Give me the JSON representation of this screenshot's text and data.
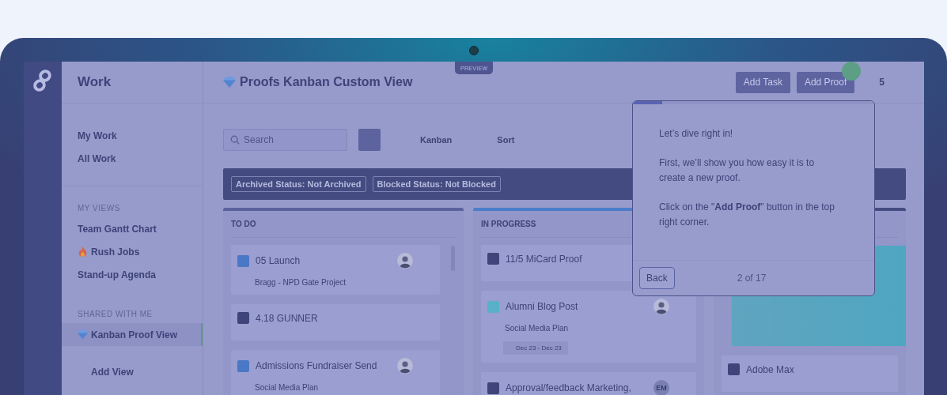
{
  "preview_badge": "PREVIEW",
  "sidebar": {
    "title": "Work",
    "sections": [
      {
        "items": [
          {
            "label": "My Work",
            "kind": "plain",
            "selected": false
          },
          {
            "label": "All Work",
            "kind": "plain",
            "selected": false
          }
        ]
      },
      {
        "heading": "MY VIEWS",
        "items": [
          {
            "label": "Team Gantt Chart",
            "kind": "plain",
            "selected": false
          },
          {
            "label": "Rush Jobs",
            "kind": "fire",
            "selected": false
          },
          {
            "label": "Stand-up Agenda",
            "kind": "plain",
            "selected": false
          }
        ]
      },
      {
        "heading": "SHARED WITH ME",
        "items": [
          {
            "label": "Kanban Proof View",
            "kind": "gem",
            "selected": true
          }
        ]
      }
    ],
    "add_view": "Add View"
  },
  "header": {
    "title": "Proofs Kanban Custom View",
    "buttons": [
      "Add Task",
      "Add Proof"
    ],
    "count": "5"
  },
  "toolbar": {
    "search": {
      "placeholder": "Search"
    },
    "view": "Kanban",
    "sort": "Sort"
  },
  "filters": [
    "Archived Status: Not Archived",
    "Blocked Status: Not Blocked"
  ],
  "columns": [
    {
      "title": "TO DO",
      "color": "#5a619e",
      "scrollbar": true,
      "cards": [
        {
          "kind": "task",
          "title": "05 Launch",
          "color": "#4a78c6",
          "subtitle": "Bragg - NPD Gate Project",
          "avatar": true
        },
        {
          "kind": "task",
          "title": "4.18 GUNNER",
          "color": "#3f457a"
        },
        {
          "kind": "task",
          "title": "Admissions Fundraiser Send",
          "color": "#4a78c6",
          "subtitle": "Social Media Plan",
          "avatar": true
        }
      ]
    },
    {
      "title": "IN PROGRESS",
      "color": "#4c7dcc",
      "cards": [
        {
          "kind": "task",
          "title": "11/5 MiCard Proof",
          "color": "#3f457a"
        },
        {
          "kind": "task",
          "title": "Alumni Blog Post",
          "color": "#5aafc9",
          "subtitle": "Social Media Plan",
          "date": "Dec 23 - Dec 23",
          "avatar": true
        },
        {
          "kind": "task",
          "title": "Approval/feedback Marketing,",
          "color": "#3f457a",
          "initials": "EM"
        }
      ]
    },
    {
      "color": "#454c80",
      "cards": [
        {
          "kind": "image"
        },
        {
          "kind": "task",
          "title": "Adobe Max",
          "color": "#3f457a"
        }
      ]
    }
  ],
  "tour": {
    "level": 0.12,
    "paragraphs": [
      "Let’s dive right in!",
      "First, we’ll show you how easy it is to create a new proof.",
      "Click on the \"**Add Proof**\" button in the top right corner."
    ],
    "back": "Back",
    "step": "2 of 17"
  }
}
